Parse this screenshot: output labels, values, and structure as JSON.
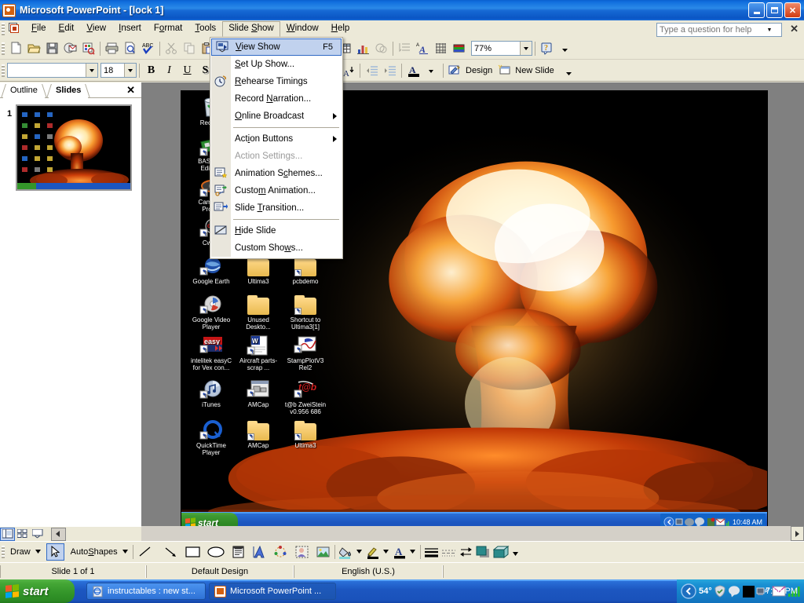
{
  "window": {
    "title_app": "Microsoft PowerPoint",
    "title_doc": "- [lock 1]",
    "icon": "powerpoint-icon",
    "minimize": "Minimize",
    "maximize": "Restore",
    "close": "Close"
  },
  "menubar": {
    "items": [
      {
        "label": "File",
        "accel": "F"
      },
      {
        "label": "Edit",
        "accel": "E"
      },
      {
        "label": "View",
        "accel": "V"
      },
      {
        "label": "Insert",
        "accel": "I"
      },
      {
        "label": "Format",
        "accel": "o"
      },
      {
        "label": "Tools",
        "accel": "T"
      },
      {
        "label": "Slide Show",
        "accel": "S",
        "open": true
      },
      {
        "label": "Window",
        "accel": "W"
      },
      {
        "label": "Help",
        "accel": "H"
      }
    ],
    "ask_box": {
      "placeholder": "Type a question for help",
      "value": "",
      "close_label": "✕"
    }
  },
  "toolbar_standard": {
    "zoom_value": "77%",
    "buttons": [
      "new-icon",
      "open-icon",
      "save-icon",
      "email-icon",
      "search-icon",
      "print-icon",
      "print-preview-icon",
      "spelling-icon",
      "cut-icon",
      "copy-icon",
      "paste-icon",
      "format-painter-icon",
      "undo-icon",
      "redo-icon",
      "insert-chart-icon",
      "insert-table-icon",
      "insert-hyperlink-icon",
      "expand-all-icon",
      "show-formatting-icon",
      "show-grid-icon",
      "color-grayscale-icon",
      "zoom-combo",
      "help-icon",
      "toolbar-options-icon"
    ]
  },
  "toolbar_formatting": {
    "font_value": "",
    "size_value": "18",
    "bold": "B",
    "italic": "I",
    "underline": "U",
    "shadow": "S",
    "design_label": "Design",
    "new_slide_label": "New Slide",
    "buttons": [
      "font-combo",
      "font-size-combo",
      "bold-icon",
      "italic-icon",
      "underline-icon",
      "text-shadow-icon",
      "align-left-icon",
      "align-center-icon",
      "align-right-icon",
      "numbered-list-icon",
      "bulleted-list-icon",
      "increase-font-size-icon",
      "decrease-font-size-icon",
      "decrease-indent-icon",
      "increase-indent-icon",
      "font-color-icon",
      "design-button",
      "new-slide-button",
      "toolbar-options-icon"
    ]
  },
  "slide_pane": {
    "tabs": [
      {
        "label": "Outline",
        "active": false
      },
      {
        "label": "Slides",
        "active": true
      }
    ],
    "close_label": "✕",
    "thumbnails": [
      {
        "number": "1"
      }
    ]
  },
  "slideshow_menu": {
    "items": [
      {
        "label": "View Show",
        "accel": "V",
        "shortcut": "F5",
        "icon": "view-show-icon",
        "highlighted": true
      },
      {
        "label": "Set Up Show...",
        "accel": "S"
      },
      {
        "label": "Rehearse Timings",
        "accel": "R",
        "icon": "rehearse-timings-icon"
      },
      {
        "label": "Record Narration...",
        "accel": "N"
      },
      {
        "label": "Online Broadcast",
        "accel": "O",
        "submenu": true
      },
      {
        "separator": true
      },
      {
        "label": "Action Buttons",
        "accel": "i",
        "submenu": true
      },
      {
        "label": "Action Settings...",
        "accel": "A",
        "disabled": true
      },
      {
        "label": "Animation Schemes...",
        "accel": "c",
        "icon": "animation-schemes-icon"
      },
      {
        "label": "Custom Animation...",
        "accel": "m",
        "icon": "custom-animation-icon"
      },
      {
        "label": "Slide Transition...",
        "accel": "T",
        "icon": "slide-transition-icon"
      },
      {
        "separator": true
      },
      {
        "label": "Hide Slide",
        "accel": "H",
        "icon": "hide-slide-icon"
      },
      {
        "label": "Custom Shows...",
        "accel": "w"
      }
    ]
  },
  "slide_content": {
    "description": "Screenshot of a Windows XP desktop with a nuclear mushroom cloud explosion wallpaper",
    "desktop_icons": [
      {
        "name": "Recycle Bin",
        "label_visible": "Recycle",
        "icon": "recycle-bin-icon"
      },
      {
        "name": "BASIC Stamp Editor",
        "label_visible": "BASIC St\nEditor v",
        "icon": "basic-stamp-icon"
      },
      {
        "name": "Cameran ProPix",
        "label_visible": "Cameran\nProPix",
        "icon": "camera-icon"
      },
      {
        "name": "CwGet",
        "label_visible": "CwGe",
        "icon": "cwget-icon"
      },
      {
        "name": "Google Earth",
        "label_visible": "Google Earth",
        "icon": "google-earth-icon"
      },
      {
        "name": "Ultima3",
        "label_visible": "Ultima3",
        "icon": "folder-icon"
      },
      {
        "name": "pcbdemo",
        "label_visible": "pcbdemo",
        "icon": "folder-shortcut-icon"
      },
      {
        "name": "Google Video Player",
        "label_visible": "Google Video Player",
        "icon": "google-video-icon"
      },
      {
        "name": "Unused Desktop",
        "label_visible": "Unused Deskto...",
        "icon": "folder-icon"
      },
      {
        "name": "Shortcut to Ultima3[1]",
        "label_visible": "Shortcut to Ultima3[1]",
        "icon": "folder-shortcut-icon"
      },
      {
        "name": "intelitek easyC for Vex",
        "label_visible": "intelitek easyC for Vex con...",
        "icon": "easyc-icon"
      },
      {
        "name": "Aircraft parts-scrap",
        "label_visible": "Aircraft parts-scrap ...",
        "icon": "word-doc-icon"
      },
      {
        "name": "StampPlotV3 Rel2",
        "label_visible": "StampPlotV3 Rel2",
        "icon": "stampplot-icon"
      },
      {
        "name": "iTunes",
        "label_visible": "iTunes",
        "icon": "itunes-icon"
      },
      {
        "name": "AMCap",
        "label_visible": "AMCap",
        "icon": "amcap-icon"
      },
      {
        "name": "t@b ZweiStein v0.956 686",
        "label_visible": "t@b ZweiStein v0.956 686",
        "icon": "zweistein-icon"
      },
      {
        "name": "QuickTime Player",
        "label_visible": "QuickTime Player",
        "icon": "quicktime-icon"
      },
      {
        "name": "AMCap folder",
        "label_visible": "AMCap",
        "icon": "folder-shortcut-icon"
      },
      {
        "name": "Ultima3 folder",
        "label_visible": "Ultima3",
        "icon": "folder-shortcut-icon"
      }
    ],
    "taskbar": {
      "start_label": "start",
      "clock": "10:48 AM"
    }
  },
  "drawing_toolbar": {
    "draw_label": "Draw",
    "autoshapes_label": "AutoShapes",
    "buttons": [
      "draw-menu",
      "select-objects-icon",
      "autoshapes-menu",
      "line-icon",
      "arrow-icon",
      "rectangle-icon",
      "oval-icon",
      "text-box-icon",
      "wordart-icon",
      "diagram-icon",
      "insert-clip-art-icon",
      "insert-picture-icon",
      "fill-color-icon",
      "line-color-icon",
      "font-color-icon",
      "line-style-icon",
      "dash-style-icon",
      "arrow-style-icon",
      "shadow-style-icon",
      "3d-style-icon",
      "toolbar-options-icon"
    ]
  },
  "view_bar": {
    "buttons": [
      "normal-view-icon",
      "slide-sorter-view-icon",
      "slide-show-view-icon"
    ]
  },
  "status_bar": {
    "slide_info": "Slide 1 of 1",
    "design": "Default Design",
    "language": "English (U.S.)"
  },
  "taskbar": {
    "start_label": "start",
    "tasks": [
      {
        "label": "instructables : new st...",
        "icon": "ie-icon",
        "active": false
      },
      {
        "label": "Microsoft PowerPoint ...",
        "icon": "powerpoint-icon",
        "active": true
      }
    ],
    "tray": {
      "icons": [
        "show-hidden-icon",
        "temperature-icon",
        "shield-icon",
        "messenger-icon",
        "black-icon",
        "network-icon",
        "mail-icon",
        "signal-icon"
      ],
      "temperature": "54°",
      "clock": "7:56 PM"
    }
  },
  "colors": {
    "title_blue": "#0a55c4",
    "chrome": "#ece9d8",
    "highlight": "#c1d2ee",
    "highlight_border": "#316ac5",
    "taskbar_blue": "#1c56c0",
    "start_green": "#34962a",
    "slide_bg": "#808080"
  }
}
